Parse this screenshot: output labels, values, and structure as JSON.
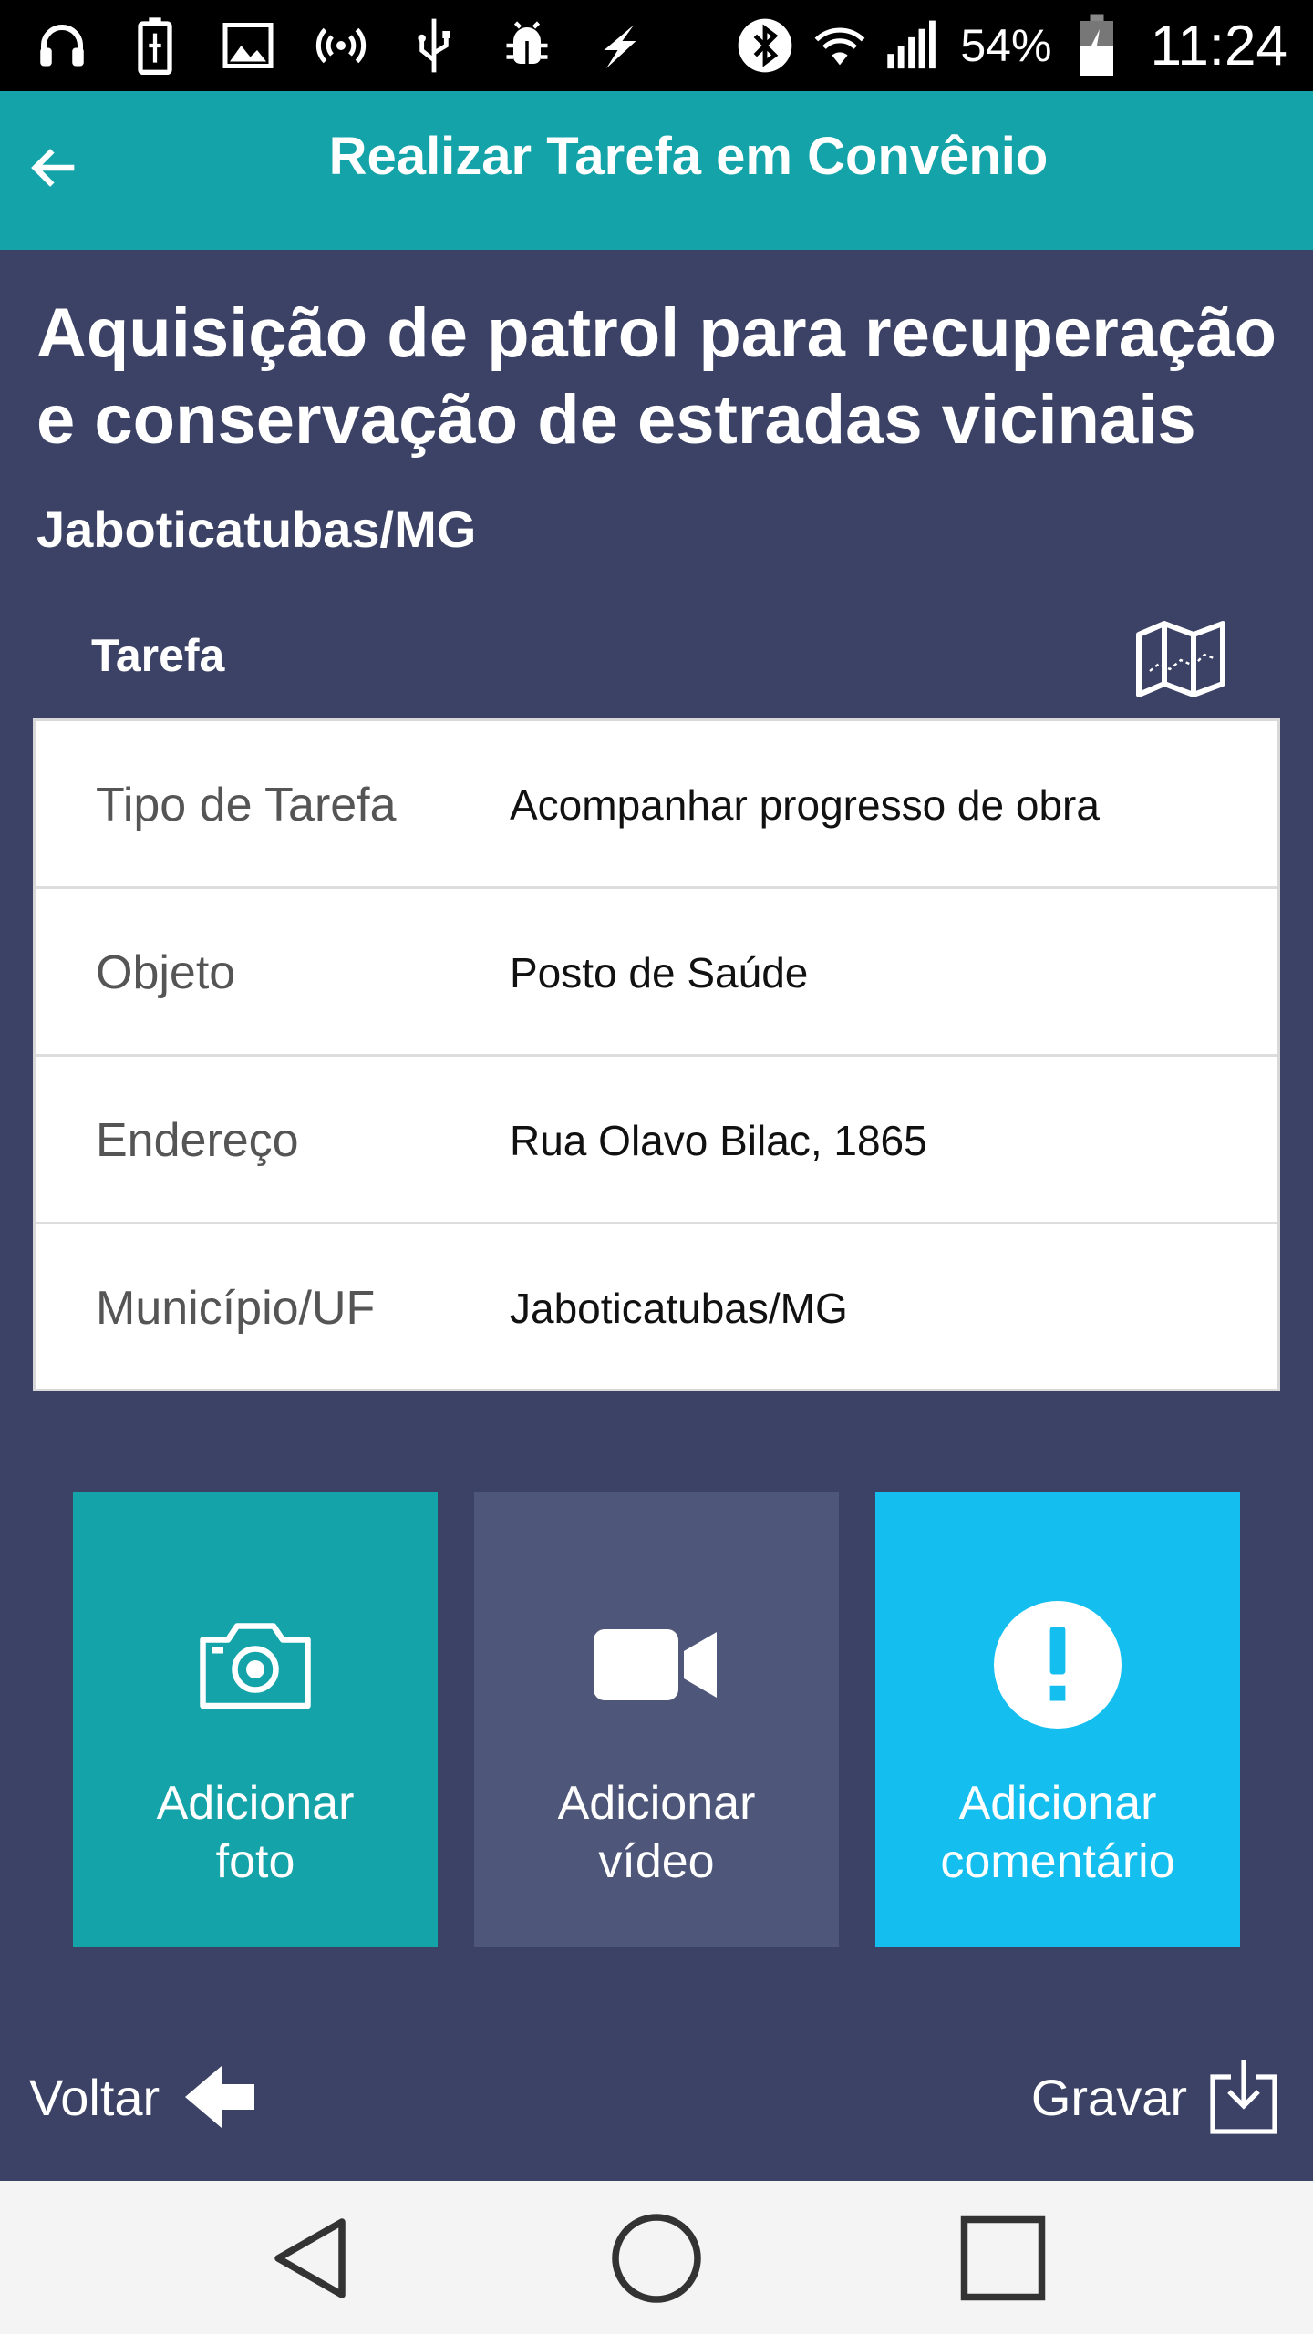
{
  "status_bar": {
    "battery_percent": "54%",
    "time": "11:24",
    "icons": [
      "headphones-icon",
      "battery-charging-icon",
      "image-icon",
      "wifi-hotspot-icon",
      "usb-icon",
      "android-debug-icon",
      "charging-bolt-icon",
      "bluetooth-icon",
      "wifi-icon",
      "signal-icon",
      "battery-icon"
    ]
  },
  "app_bar": {
    "title": "Realizar Tarefa em Convênio",
    "back_icon": "arrow-left-icon"
  },
  "project": {
    "title": "Aquisição de patrol para recuperação e conservação de estradas vicinais",
    "location": "Jaboticatubas/MG"
  },
  "task": {
    "section_label": "Tarefa",
    "map_icon": "map-icon",
    "rows": [
      {
        "label": "Tipo de Tarefa",
        "value": "Acompanhar progresso de obra"
      },
      {
        "label": "Objeto",
        "value": "Posto de Saúde"
      },
      {
        "label": "Endereço",
        "value": "Rua Olavo Bilac, 1865"
      },
      {
        "label": "Município/UF",
        "value": "Jaboticatubas/MG"
      }
    ]
  },
  "actions": {
    "photo": {
      "line1": "Adicionar",
      "line2": "foto",
      "icon": "camera-icon",
      "color": "#13a3a8"
    },
    "video": {
      "line1": "Adicionar",
      "line2": "vídeo",
      "icon": "video-camera-icon",
      "color": "#4e5679"
    },
    "comment": {
      "line1": "Adicionar",
      "line2": "comentário",
      "icon": "alert-circle-icon",
      "color": "#14bff0"
    }
  },
  "footer": {
    "back_label": "Voltar",
    "save_label": "Gravar"
  },
  "colors": {
    "app_bar": "#13a3a8",
    "background": "#3c4265",
    "accent_blue": "#14bff0"
  }
}
